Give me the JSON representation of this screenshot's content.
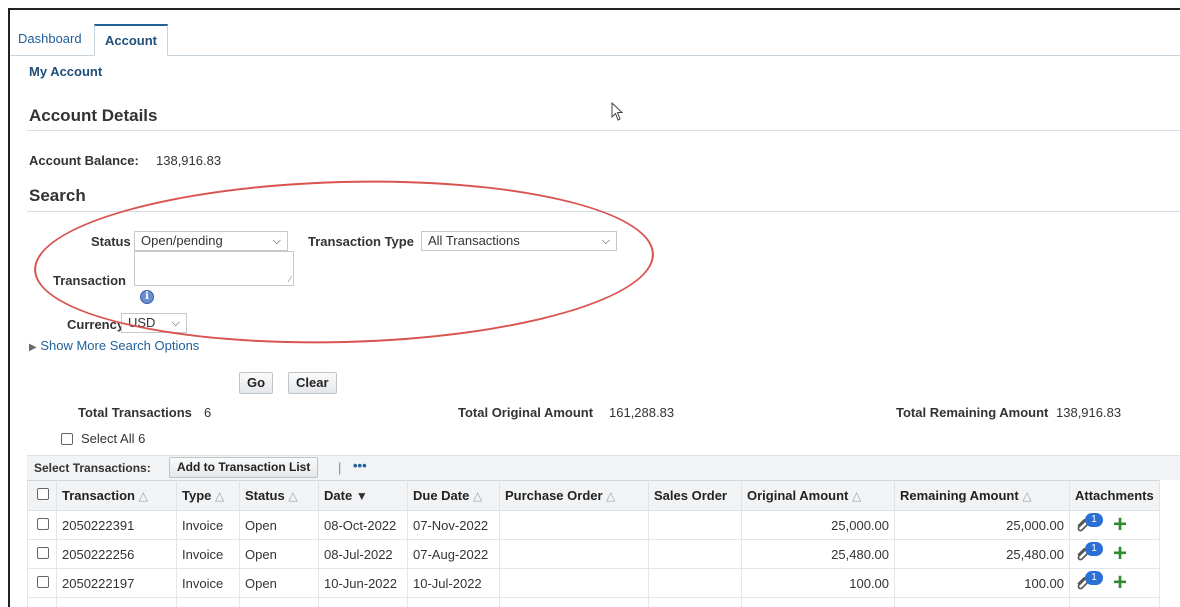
{
  "tabs": [
    {
      "label": "Dashboard",
      "active": false
    },
    {
      "label": "Account",
      "active": true
    }
  ],
  "breadcrumb": "My Account",
  "account_details": {
    "heading": "Account Details",
    "balance_label": "Account Balance:",
    "balance_value": "138,916.83"
  },
  "search": {
    "heading": "Search",
    "status_label": "Status",
    "status_value": "Open/pending",
    "type_label": "Transaction Type",
    "type_value": "All Transactions",
    "transaction_label": "Transaction",
    "transaction_value": "",
    "currency_label": "Currency",
    "currency_value": "USD",
    "more_options": "Show More Search Options",
    "go_label": "Go",
    "clear_label": "Clear"
  },
  "totals": {
    "count_label": "Total Transactions",
    "count_value": "6",
    "original_label": "Total Original Amount",
    "original_value": "161,288.83",
    "remaining_label": "Total Remaining Amount",
    "remaining_value": "138,916.83"
  },
  "select_all_label": "Select All 6",
  "toolbar": {
    "select_label": "Select Transactions:",
    "add_button": "Add to Transaction List",
    "separator": "|",
    "more": "•••"
  },
  "columns": [
    "Transaction",
    "Type",
    "Status",
    "Date",
    "Due Date",
    "Purchase Order",
    "Sales Order",
    "Original Amount",
    "Remaining Amount",
    "Attachments"
  ],
  "rows": [
    {
      "transaction": "2050222391",
      "type": "Invoice",
      "status": "Open",
      "date": "08-Oct-2022",
      "due": "07-Nov-2022",
      "po": "",
      "so": "",
      "original": "25,000.00",
      "remaining": "25,000.00",
      "attachments": "1"
    },
    {
      "transaction": "2050222256",
      "type": "Invoice",
      "status": "Open",
      "date": "08-Jul-2022",
      "due": "07-Aug-2022",
      "po": "",
      "so": "",
      "original": "25,480.00",
      "remaining": "25,480.00",
      "attachments": "1"
    },
    {
      "transaction": "2050222197",
      "type": "Invoice",
      "status": "Open",
      "date": "10-Jun-2022",
      "due": "10-Jul-2022",
      "po": "",
      "so": "",
      "original": "100.00",
      "remaining": "100.00",
      "attachments": "1"
    },
    {
      "transaction": "",
      "type": "",
      "status": "",
      "date": "",
      "due": "",
      "po": "",
      "so": "",
      "original": "",
      "remaining": "",
      "attachments": ""
    }
  ],
  "colors": {
    "link": "#1f5f9a",
    "annotation": "#d9534f",
    "badge": "#2a6fd6",
    "plus": "#2e8b2e"
  }
}
